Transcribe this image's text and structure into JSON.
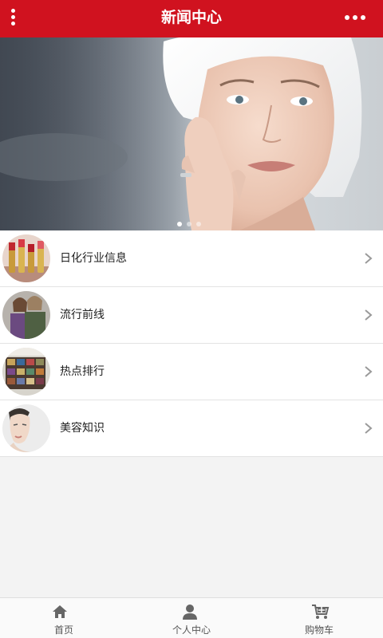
{
  "header": {
    "title": "新闻中心",
    "menu_icon": "vertical-dots-icon",
    "more_icon": "horizontal-dots-icon",
    "bg_color": "#d0121f"
  },
  "banner": {
    "slide_count": 3,
    "active_index": 0
  },
  "list": {
    "items": [
      {
        "label": "日化行业信息",
        "icon": "lipstick-thumbnail"
      },
      {
        "label": "流行前线",
        "icon": "fashion-models-thumbnail"
      },
      {
        "label": "热点排行",
        "icon": "store-shelf-thumbnail"
      },
      {
        "label": "美容知识",
        "icon": "face-beauty-thumbnail"
      }
    ],
    "chevron_icon": "chevron-right-icon"
  },
  "tabbar": {
    "tabs": [
      {
        "label": "首页",
        "icon": "home-icon"
      },
      {
        "label": "个人中心",
        "icon": "user-icon"
      },
      {
        "label": "购物车",
        "icon": "cart-icon"
      }
    ]
  }
}
